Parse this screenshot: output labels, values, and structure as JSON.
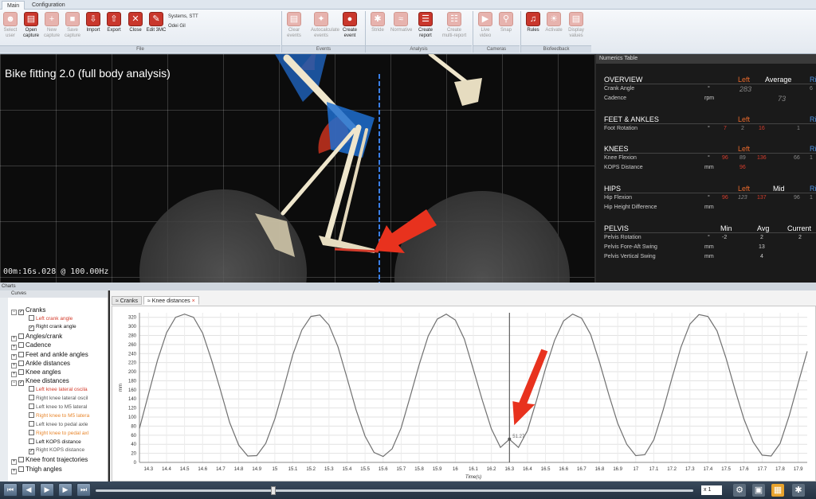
{
  "menu": {
    "tabs": [
      "Main",
      "Configuration"
    ]
  },
  "ribbon": {
    "file_buttons": [
      {
        "label": "Select user",
        "disabled": true
      },
      {
        "label": "Open capture",
        "disabled": false
      },
      {
        "label": "New capture",
        "disabled": true
      },
      {
        "label": "Save capture",
        "disabled": true
      },
      {
        "label": "Import",
        "disabled": false
      },
      {
        "label": "Export",
        "disabled": false
      },
      {
        "label": "Close",
        "disabled": false
      },
      {
        "label": "Edit 3MC",
        "disabled": false
      }
    ],
    "systems_label": "Systems, STT",
    "user_label": "Odei Gil",
    "events_buttons": [
      {
        "label": "Clear events",
        "disabled": true
      },
      {
        "label": "Autocalculate events",
        "disabled": true
      },
      {
        "label": "Create event",
        "disabled": false
      }
    ],
    "analysis_buttons": [
      {
        "label": "Stride",
        "disabled": true
      },
      {
        "label": "Normative",
        "disabled": true
      },
      {
        "label": "Create report",
        "disabled": false
      },
      {
        "label": "Create multi-report",
        "disabled": true
      }
    ],
    "cameras_buttons": [
      {
        "label": "Live video",
        "disabled": true
      },
      {
        "label": "Snap",
        "disabled": true
      }
    ],
    "biofeedback_buttons": [
      {
        "label": "Rules",
        "disabled": false
      },
      {
        "label": "Activate",
        "disabled": true
      },
      {
        "label": "Display values",
        "disabled": true
      }
    ],
    "group_labels": {
      "file": "File",
      "events": "Events",
      "analysis": "Analysis",
      "cameras": "Cameras",
      "biofeedback": "Biofeedback"
    }
  },
  "viewport": {
    "title": "Bike fitting 2.0 (full body analysis)",
    "timecode": "00m:16s.028 @ 100.00Hz"
  },
  "numerics": {
    "header": "Numerics Table",
    "sections": {
      "overview": {
        "title": "OVERVIEW",
        "left": "Left",
        "avg": "Average",
        "right": "Ri",
        "rows": [
          {
            "label": "Crank Angle",
            "unit": "°",
            "left": "283",
            "avg": "",
            "right": "6"
          },
          {
            "label": "Cadence",
            "unit": "rpm",
            "left": "",
            "avg": "73",
            "right": ""
          }
        ]
      },
      "feet": {
        "title": "FEET & ANKLES",
        "left": "Left",
        "right": "Ri",
        "rows": [
          {
            "label": "Foot Rotation",
            "unit": "°",
            "v1": "7",
            "v2": "2",
            "v3": "16",
            "v4": "1"
          }
        ]
      },
      "knees": {
        "title": "KNEES",
        "left": "Left",
        "right": "Ri",
        "rows": [
          {
            "label": "Knee Flexion",
            "unit": "°",
            "v1": "96",
            "v2": "89",
            "v3": "136",
            "v4": "66",
            "v5": "1"
          },
          {
            "label": "KOPS Distance",
            "unit": "mm",
            "v1": "",
            "v2": "96",
            "v3": ""
          }
        ]
      },
      "hips": {
        "title": "HIPS",
        "left": "Left",
        "mid": "Mid",
        "right": "Ri",
        "rows": [
          {
            "label": "Hip Flexion",
            "unit": "°",
            "v1": "96",
            "v2": "123",
            "v3": "137",
            "v4": "96",
            "v5": "1"
          },
          {
            "label": "Hip Height Difference",
            "unit": "mm"
          }
        ]
      },
      "pelvis": {
        "title": "PELVIS",
        "min": "Min",
        "avg": "Avg",
        "current": "Current",
        "rows": [
          {
            "label": "Pelvis Rotation",
            "unit": "°",
            "min": "-2",
            "avg": "2",
            "current": "2"
          },
          {
            "label": "Pelvis Fore-Aft Swing",
            "unit": "mm",
            "min": "",
            "avg": "13",
            "current": ""
          },
          {
            "label": "Pelvis Vertical Swing",
            "unit": "mm",
            "min": "",
            "avg": "4",
            "current": ""
          }
        ]
      }
    }
  },
  "charts": {
    "panel_title": "Charts",
    "curves_title": "Curves",
    "tabs": [
      "Cranks",
      "Knee distances"
    ],
    "tree": [
      {
        "label": "Cranks",
        "level": 0,
        "checked": true,
        "color": "#111"
      },
      {
        "label": "Left crank angle",
        "level": 1,
        "checked": false,
        "color": "#d43c2c"
      },
      {
        "label": "Right crank angle",
        "level": 1,
        "checked": true,
        "color": "#111"
      },
      {
        "label": "Angles/crank",
        "level": 0,
        "checked": false,
        "color": "#111"
      },
      {
        "label": "Cadence",
        "level": 0,
        "checked": false,
        "color": "#111"
      },
      {
        "label": "Feet and ankle angles",
        "level": 0,
        "checked": false,
        "color": "#111"
      },
      {
        "label": "Ankle distances",
        "level": 0,
        "checked": false,
        "color": "#111"
      },
      {
        "label": "Knee angles",
        "level": 0,
        "checked": false,
        "color": "#111"
      },
      {
        "label": "Knee distances",
        "level": 0,
        "checked": true,
        "color": "#111"
      },
      {
        "label": "Left knee lateral oscila",
        "level": 1,
        "checked": false,
        "color": "#d43c2c"
      },
      {
        "label": "Right knee lateral oscil",
        "level": 1,
        "checked": false,
        "color": "#555"
      },
      {
        "label": "Left knee to M5 lateral",
        "level": 1,
        "checked": false,
        "color": "#555"
      },
      {
        "label": "Right knee to M5 latera",
        "level": 1,
        "checked": false,
        "color": "#e8862c"
      },
      {
        "label": "Left knee to pedal axle",
        "level": 1,
        "checked": false,
        "color": "#555"
      },
      {
        "label": "Right knee to pedal axl",
        "level": 1,
        "checked": false,
        "color": "#e8862c"
      },
      {
        "label": "Left KOPS distance",
        "level": 1,
        "checked": false,
        "color": "#111"
      },
      {
        "label": "Right KOPS distance",
        "level": 1,
        "checked": true,
        "color": "#555"
      },
      {
        "label": "Knee front trajectories",
        "level": 0,
        "checked": false,
        "color": "#111"
      },
      {
        "label": "Thigh angles",
        "level": 0,
        "checked": false,
        "color": "#111"
      }
    ],
    "cursor_label": "51.27"
  },
  "chart_data": {
    "type": "line",
    "title": "",
    "xlabel": "Time(s)",
    "ylabel": "mm",
    "xlim": [
      14.25,
      17.95
    ],
    "ylim": [
      0,
      330
    ],
    "x_ticks": [
      14.3,
      14.4,
      14.5,
      14.6,
      14.7,
      14.8,
      14.9,
      15,
      15.1,
      15.2,
      15.3,
      15.4,
      15.5,
      15.6,
      15.7,
      15.8,
      15.9,
      16,
      16.1,
      16.2,
      16.3,
      16.4,
      16.5,
      16.6,
      16.7,
      16.8,
      16.9,
      17,
      17.1,
      17.2,
      17.3,
      17.4,
      17.5,
      17.6,
      17.7,
      17.8,
      17.9
    ],
    "y_ticks": [
      0,
      20,
      40,
      60,
      80,
      100,
      120,
      140,
      160,
      180,
      200,
      220,
      240,
      260,
      280,
      300,
      320
    ],
    "grid": true,
    "cursor_x": 16.3,
    "series": [
      {
        "name": "Right KOPS distance",
        "peaks": [
          14.51,
          15.32,
          16.13,
          16.94,
          17.75
        ],
        "troughs": [
          14.91,
          15.72,
          16.53,
          17.34
        ],
        "min": 13,
        "max": 327,
        "x": [
          14.25,
          14.3,
          14.35,
          14.4,
          14.45,
          14.5,
          14.55,
          14.6,
          14.65,
          14.7,
          14.75,
          14.8,
          14.85,
          14.9,
          14.95,
          15.0,
          15.05,
          15.1,
          15.15,
          15.2,
          15.25,
          15.3,
          15.35,
          15.4,
          15.45,
          15.5,
          15.55,
          15.6,
          15.65,
          15.7,
          15.75,
          15.8,
          15.85,
          15.9,
          15.95,
          16.0,
          16.05,
          16.1,
          16.15,
          16.2,
          16.25,
          16.3,
          16.35,
          16.4,
          16.45,
          16.5,
          16.55,
          16.6,
          16.65,
          16.7,
          16.75,
          16.8,
          16.85,
          16.9,
          16.95,
          17.0,
          17.05,
          17.1,
          17.15,
          17.2,
          17.25,
          17.3,
          17.35,
          17.4,
          17.45,
          17.5,
          17.55,
          17.6,
          17.65,
          17.7,
          17.75,
          17.8,
          17.85,
          17.9,
          17.95
        ],
        "y": [
          75,
          150,
          225,
          286,
          320,
          327,
          320,
          285,
          225,
          158,
          88,
          38,
          14,
          15,
          42,
          96,
          165,
          238,
          292,
          322,
          325,
          303,
          255,
          186,
          116,
          58,
          22,
          13,
          30,
          76,
          145,
          216,
          279,
          316,
          327,
          314,
          272,
          205,
          137,
          74,
          33,
          51,
          33,
          70,
          137,
          207,
          269,
          312,
          327,
          318,
          282,
          220,
          150,
          86,
          40,
          15,
          17,
          50,
          113,
          185,
          254,
          305,
          326,
          322,
          290,
          230,
          160,
          95,
          45,
          16,
          14,
          42,
          103,
          175,
          245
        ]
      }
    ]
  },
  "transport": {
    "speed": "x 1",
    "buttons": [
      "first-frame",
      "prev-frame",
      "play",
      "next-frame",
      "last-frame"
    ]
  }
}
